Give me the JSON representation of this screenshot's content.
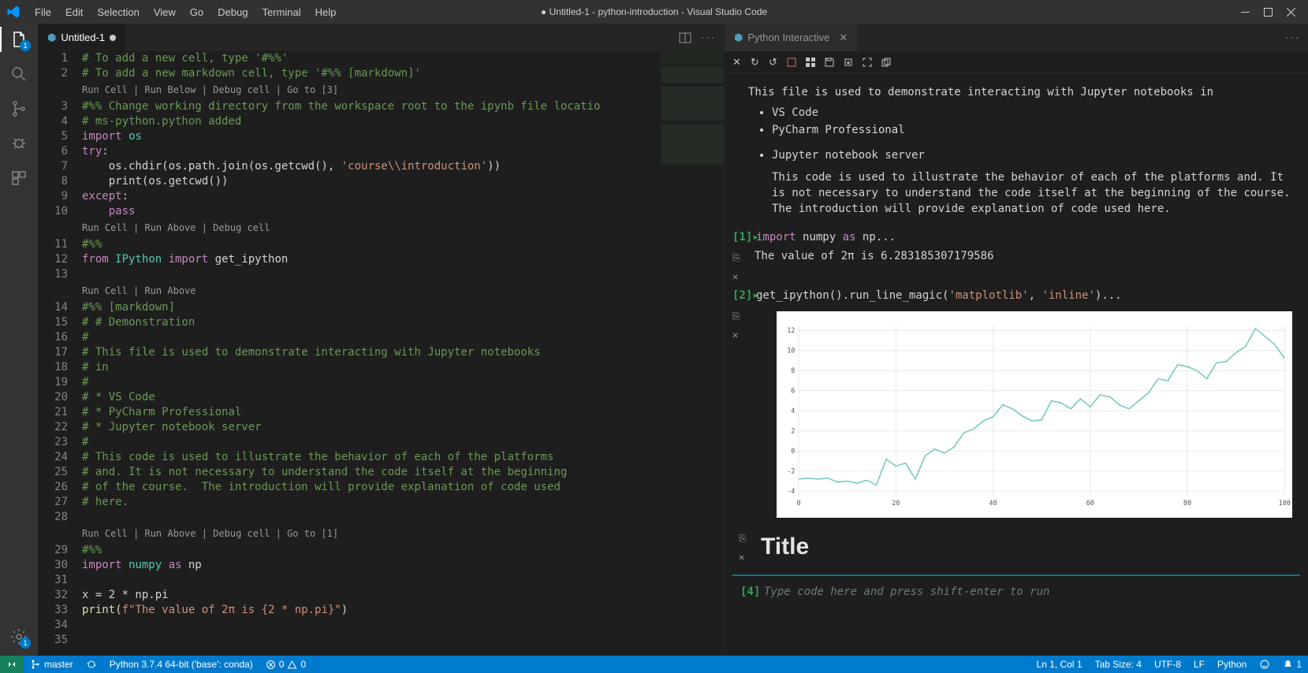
{
  "title": "● Untitled-1 - python-introduction - Visual Studio Code",
  "menu": [
    "File",
    "Edit",
    "Selection",
    "View",
    "Go",
    "Debug",
    "Terminal",
    "Help"
  ],
  "activity": {
    "files_badge": "1",
    "gear_badge": "1"
  },
  "tab": {
    "left_name": "Untitled-1",
    "right_name": "Python Interactive"
  },
  "codelens": {
    "c1": "Run Cell | Run Below | Debug cell | Go to [3]",
    "c2": "Run Cell | Run Above | Debug cell",
    "c3": "Run Cell | Run Above",
    "c4": "Run Cell | Run Above | Debug cell | Go to [1]"
  },
  "code": {
    "l1": "# To add a new cell, type '#%%'",
    "l2": "# To add a new markdown cell, type '#%% [markdown]'",
    "l3": "#%% Change working directory from the workspace root to the ipynb file locatio",
    "l4": "# ms-python.python added",
    "l5_kw": "import",
    "l5_mod": " os",
    "l6_kw": "try",
    "l6_colon": ":",
    "l7": "    os.chdir(os.path.join(os.getcwd(), ",
    "l7_str": "'course\\\\introduction'",
    "l7_end": "))",
    "l8": "    print(os.getcwd())",
    "l9_kw": "except",
    "l9_colon": ":",
    "l10_kw": "    pass",
    "l11": "#%%",
    "l12_from": "from",
    "l12_mod": " IPython ",
    "l12_imp": "import",
    "l12_name": " get_ipython",
    "l13": "",
    "l14": "#%% [markdown]",
    "l15": "# # Demonstration",
    "l16": "#",
    "l17": "# This file is used to demonstrate interacting with Jupyter notebooks",
    "l18": "# in",
    "l19": "#",
    "l20": "# * VS Code",
    "l21": "# * PyCharm Professional",
    "l22": "# * Jupyter notebook server",
    "l23": "#",
    "l24": "# This code is used to illustrate the behavior of each of the platforms",
    "l25": "# and. It is not necessary to understand the code itself at the beginning",
    "l26": "# of the course.  The introduction will provide explanation of code used",
    "l27": "# here.",
    "l28": "",
    "l29": "#%%",
    "l30_imp": "import",
    "l30_mod": " numpy ",
    "l30_as": "as",
    "l30_name": " np",
    "l31": "",
    "l32": "x = 2 * np.pi",
    "l33_a": "print(",
    "l33_b": "f\"The value of 2π is {2 * np.pi}\"",
    "l33_c": ")",
    "l34": ""
  },
  "interactive": {
    "md_intro": "This file is used to demonstrate interacting with Jupyter notebooks in",
    "md_li1": "VS Code",
    "md_li2": "PyCharm Professional",
    "md_li3": "Jupyter notebook server",
    "md_para": "This code is used to illustrate the behavior of each of the platforms and. It is not necessary to understand the code itself at the beginning of the course. The introduction will provide explanation of code used here.",
    "cell1_label": "[1]",
    "cell1_imp": "import",
    "cell1_mod": " numpy ",
    "cell1_as": "as",
    "cell1_name": " np...",
    "out1": "The value of 2π is 6.283185307179586",
    "cell2_label": "[2]",
    "cell2_code_a": "get_ipython().run_line_magic(",
    "cell2_code_b": "'matplotlib'",
    "cell2_code_c": ", ",
    "cell2_code_d": "'inline'",
    "cell2_code_e": ")...",
    "title_heading": "Title",
    "cell4_label": "[4]",
    "input_ph": "Type code here and press shift-enter to run"
  },
  "chart_data": {
    "type": "line",
    "xlabel": "",
    "ylabel": "",
    "x_ticks": [
      0,
      20,
      40,
      60,
      80,
      100
    ],
    "y_ticks": [
      -4,
      -2,
      0,
      2,
      4,
      6,
      8,
      10,
      12
    ],
    "xlim": [
      0,
      100
    ],
    "ylim": [
      -4.5,
      12.5
    ],
    "x": [
      0,
      2,
      4,
      6,
      8,
      10,
      12,
      14,
      16,
      18,
      20,
      22,
      24,
      26,
      28,
      30,
      32,
      34,
      36,
      38,
      40,
      42,
      44,
      46,
      48,
      50,
      52,
      54,
      56,
      58,
      60,
      62,
      64,
      66,
      68,
      70,
      72,
      74,
      76,
      78,
      80,
      82,
      84,
      86,
      88,
      90,
      92,
      94,
      96,
      98,
      100
    ],
    "y": [
      -2.8,
      -2.7,
      -2.8,
      -2.7,
      -3.1,
      -3.0,
      -3.2,
      -2.9,
      -3.4,
      -0.8,
      -1.5,
      -1.2,
      -2.8,
      -0.5,
      0.2,
      -0.2,
      0.4,
      1.8,
      2.2,
      3.0,
      3.4,
      4.6,
      4.2,
      3.5,
      3.0,
      3.1,
      5.0,
      4.8,
      4.2,
      5.2,
      4.4,
      5.6,
      5.4,
      4.6,
      4.2,
      5.0,
      5.8,
      7.2,
      7.0,
      8.6,
      8.4,
      8.0,
      7.2,
      8.8,
      8.9,
      9.8,
      10.4,
      12.2,
      11.4,
      10.6,
      9.2
    ]
  },
  "status": {
    "branch": "master",
    "python": "Python 3.7.4 64-bit ('base': conda)",
    "errors": "0",
    "warnings": "0",
    "ln": "Ln 1, Col 1",
    "tab": "Tab Size: 4",
    "enc": "UTF-8",
    "eol": "LF",
    "lang": "Python",
    "bell": "1"
  }
}
